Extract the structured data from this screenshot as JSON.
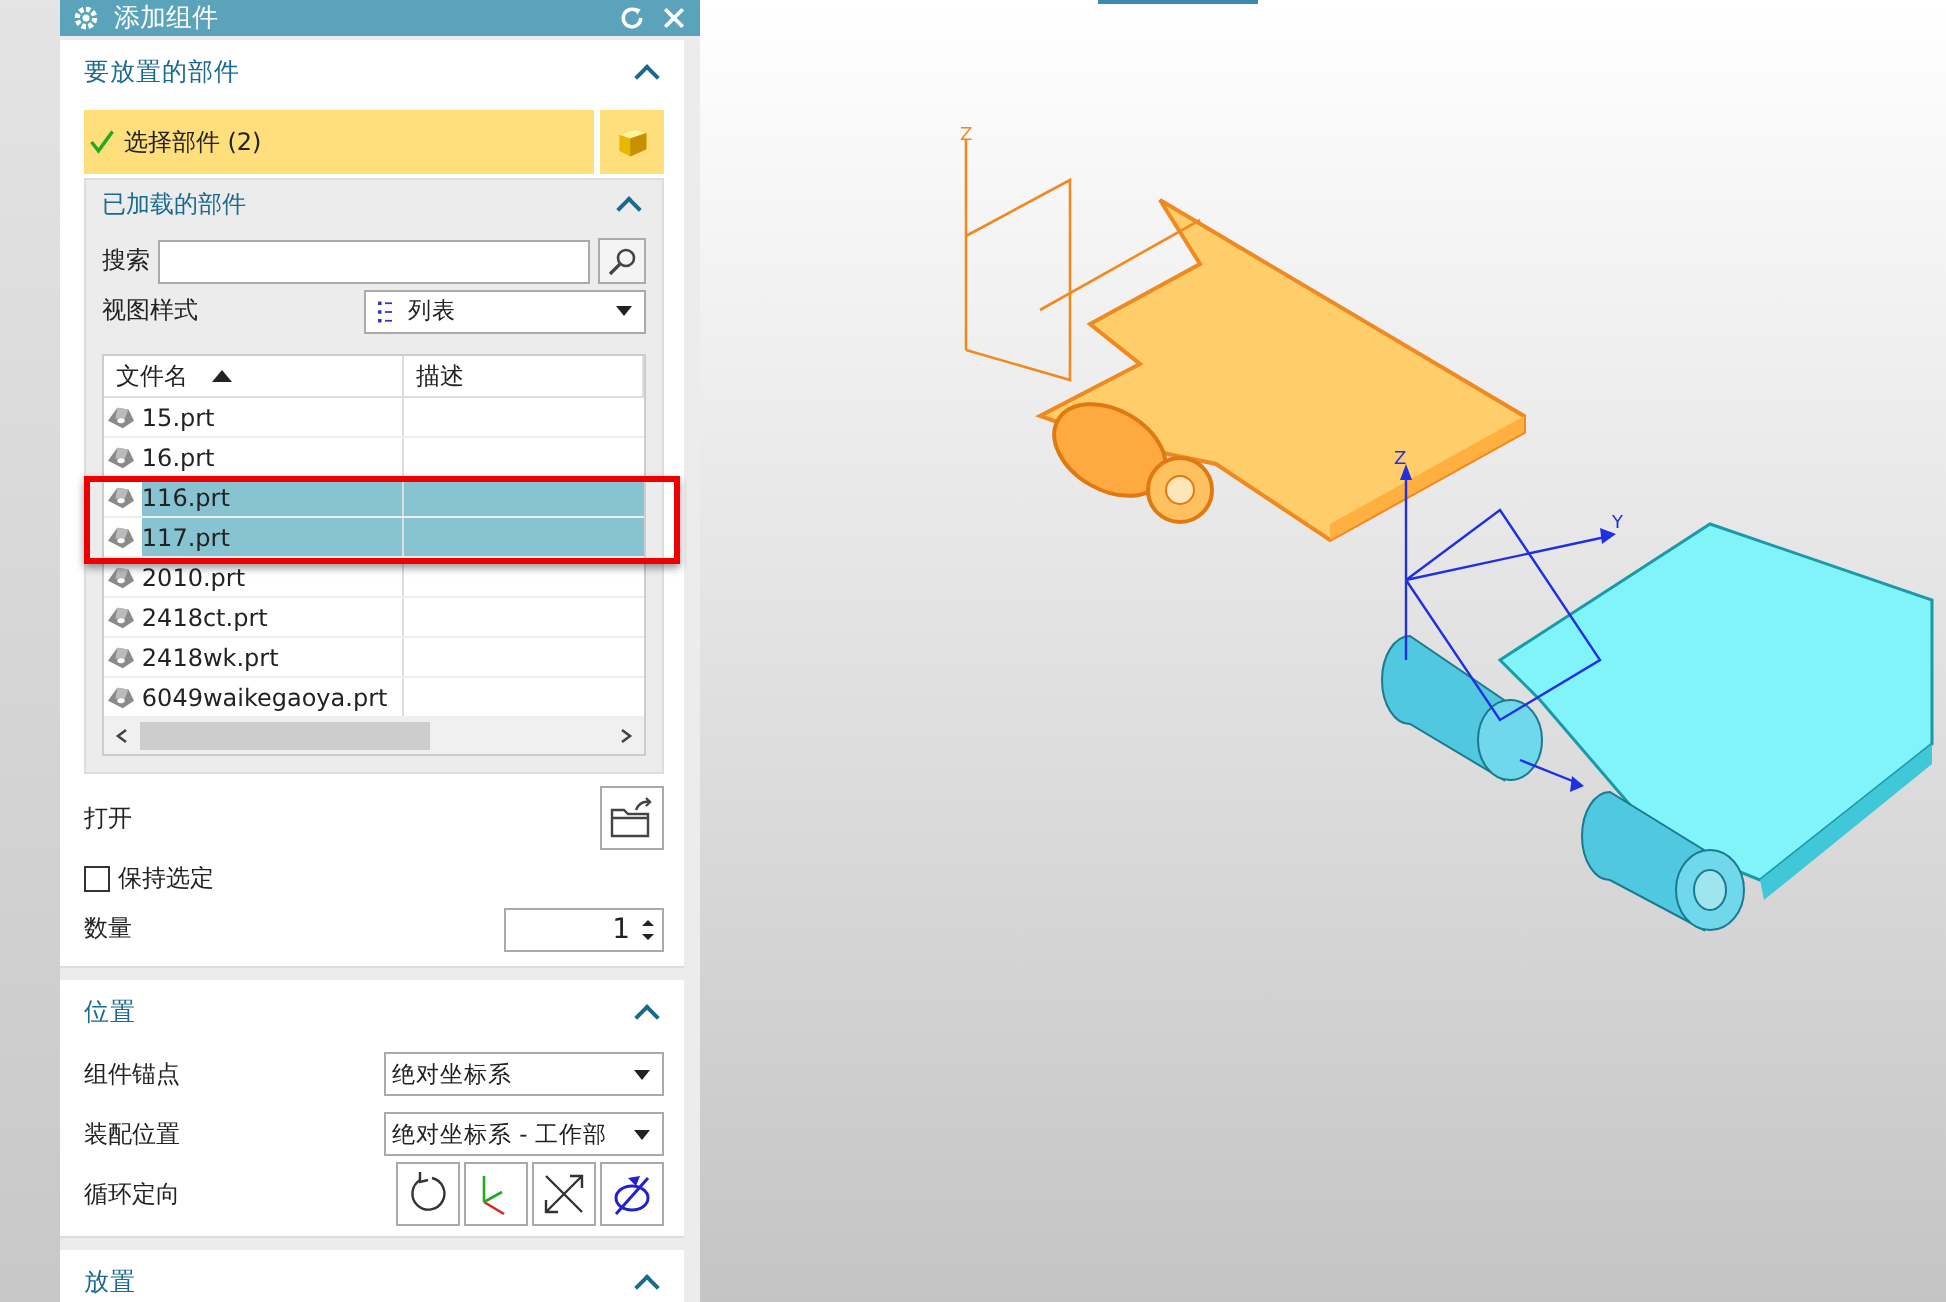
{
  "dialog": {
    "title": "添加组件"
  },
  "parts_section": {
    "title": "要放置的部件",
    "expanded": true,
    "select_label": "选择部件 (2)"
  },
  "loaded_section": {
    "title": "已加载的部件",
    "expanded": true,
    "search_label": "搜索",
    "view_style_label": "视图样式",
    "view_style_value": "列表",
    "columns": [
      {
        "label": "文件名",
        "sorted": true
      },
      {
        "label": "描述",
        "sorted": false
      }
    ],
    "rows": [
      {
        "name": "15.prt",
        "selected": false
      },
      {
        "name": "16.prt",
        "selected": false
      },
      {
        "name": "116.prt",
        "selected": true
      },
      {
        "name": "117.prt",
        "selected": true
      },
      {
        "name": "2010.prt",
        "selected": false
      },
      {
        "name": "2418ct.prt",
        "selected": false
      },
      {
        "name": "2418wk.prt",
        "selected": false
      },
      {
        "name": "6049waikegaoya.prt",
        "selected": false
      }
    ]
  },
  "open_label": "打开",
  "keep_selection": {
    "label": "保持选定",
    "checked": false
  },
  "quantity": {
    "label": "数量",
    "value": "1"
  },
  "position_section": {
    "title": "位置",
    "expanded": true,
    "fields": [
      {
        "label": "组件锚点",
        "value": "绝对坐标系"
      },
      {
        "label": "装配位置",
        "value": "绝对坐标系 - 工作部"
      }
    ],
    "cycle_label": "循环定向"
  },
  "placement_section": {
    "title": "放置",
    "expanded": true
  },
  "viewport": {
    "axis_labels": [
      "Z",
      "Z",
      "Y"
    ]
  }
}
